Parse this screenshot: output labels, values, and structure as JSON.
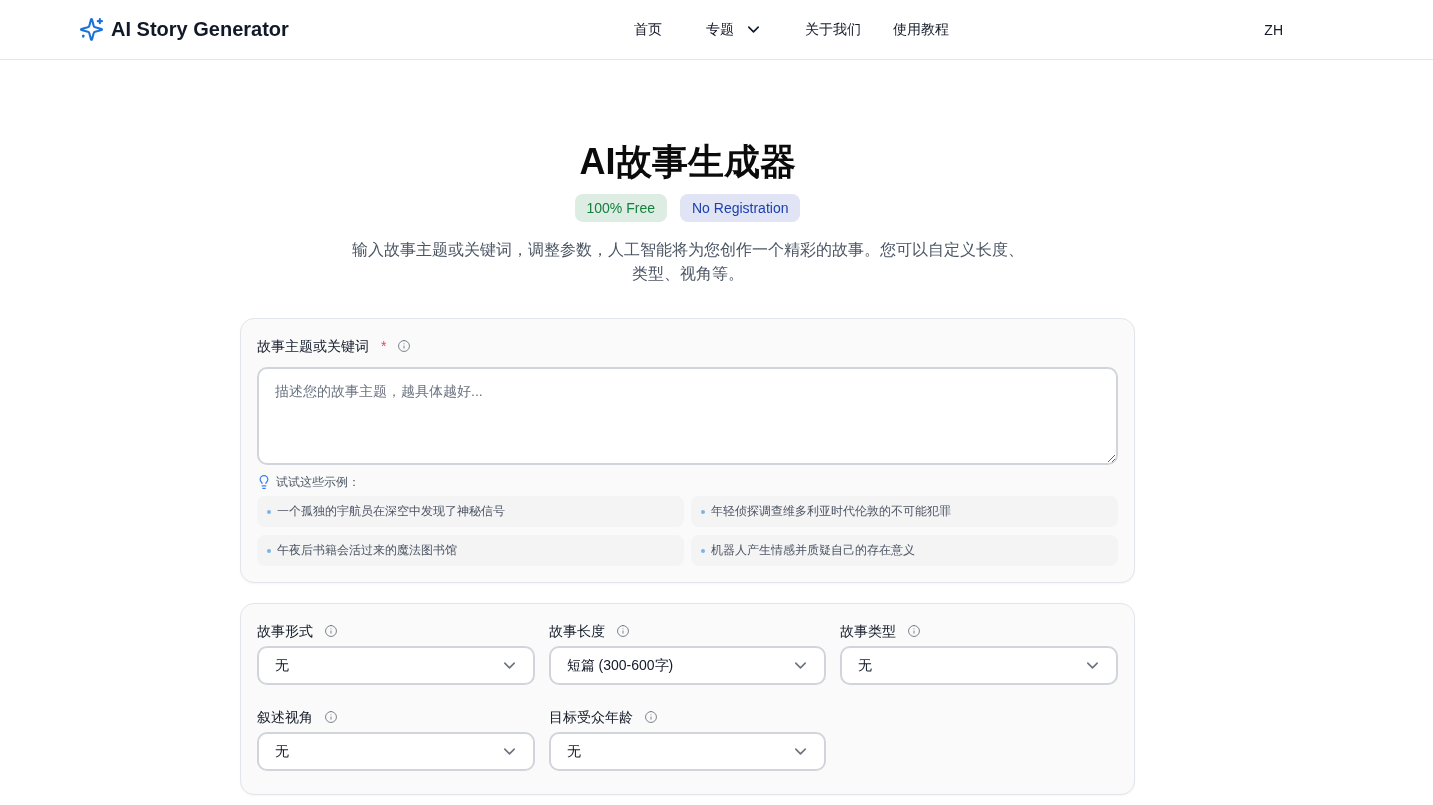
{
  "header": {
    "logo": "AI Story Generator",
    "nav": [
      {
        "label": "首页",
        "kind": "link"
      },
      {
        "label": "专题",
        "kind": "dropdown"
      },
      {
        "label": "关于我们",
        "kind": "link"
      },
      {
        "label": "使用教程",
        "kind": "link"
      }
    ],
    "language": "ZH"
  },
  "hero": {
    "title": "AI故事生成器",
    "badges": [
      {
        "label": "100% Free",
        "color": "#15803d"
      },
      {
        "label": "No Registration",
        "color": "#1e40af"
      }
    ],
    "description": "输入故事主题或关键词，调整参数，人工智能将为您创作一个精彩的故事。您可以自定义长度、类型、视角等。"
  },
  "topic_card": {
    "label": "故事主题或关键词",
    "required_mark": "*",
    "placeholder": "描述您的故事主题，越具体越好...",
    "examples_heading": "试试这些示例：",
    "examples": [
      "一个孤独的宇航员在深空中发现了神秘信号",
      "年轻侦探调查维多利亚时代伦敦的不可能犯罪",
      "午夜后书籍会活过来的魔法图书馆",
      "机器人产生情感并质疑自己的存在意义"
    ]
  },
  "options_card": {
    "fields": [
      {
        "label": "故事形式",
        "value": "无"
      },
      {
        "label": "故事长度",
        "value": "短篇 (300-600字)"
      },
      {
        "label": "故事类型",
        "value": "无"
      },
      {
        "label": "叙述视角",
        "value": "无"
      },
      {
        "label": "目标受众年龄",
        "value": "无"
      }
    ]
  }
}
